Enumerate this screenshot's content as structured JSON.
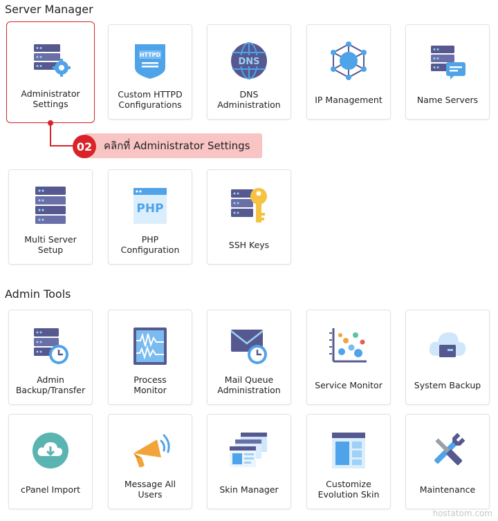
{
  "sections": {
    "server_manager": "Server Manager",
    "admin_tools": "Admin Tools"
  },
  "cards": {
    "administrator_settings": "Administrator\nSettings",
    "custom_httpd": "Custom HTTPD\nConfigurations",
    "dns_admin": "DNS\nAdministration",
    "ip_management": "IP Management",
    "name_servers": "Name Servers",
    "multi_server": "Multi Server\nSetup",
    "php_config": "PHP\nConfiguration",
    "ssh_keys": "SSH Keys",
    "admin_backup": "Admin\nBackup/Transfer",
    "process_monitor": "Process\nMonitor",
    "mail_queue": "Mail Queue\nAdministration",
    "service_monitor": "Service Monitor",
    "system_backup": "System Backup",
    "cpanel_import": "cPanel Import",
    "message_all": "Message All\nUsers",
    "skin_manager": "Skin Manager",
    "customize_evolution": "Customize\nEvolution Skin",
    "maintenance": "Maintenance"
  },
  "icon_text": {
    "httpd": "HTTPD",
    "dns": "DNS",
    "php": "PHP"
  },
  "callout": {
    "step": "02",
    "text": "คลิกที่ Administrator Settings"
  },
  "watermark": "hostatom.com",
  "colors": {
    "accent_red": "#d9232a",
    "callout_bg": "#f9c4c4",
    "icon_blue": "#4fa3e8",
    "icon_navy": "#55598f"
  }
}
